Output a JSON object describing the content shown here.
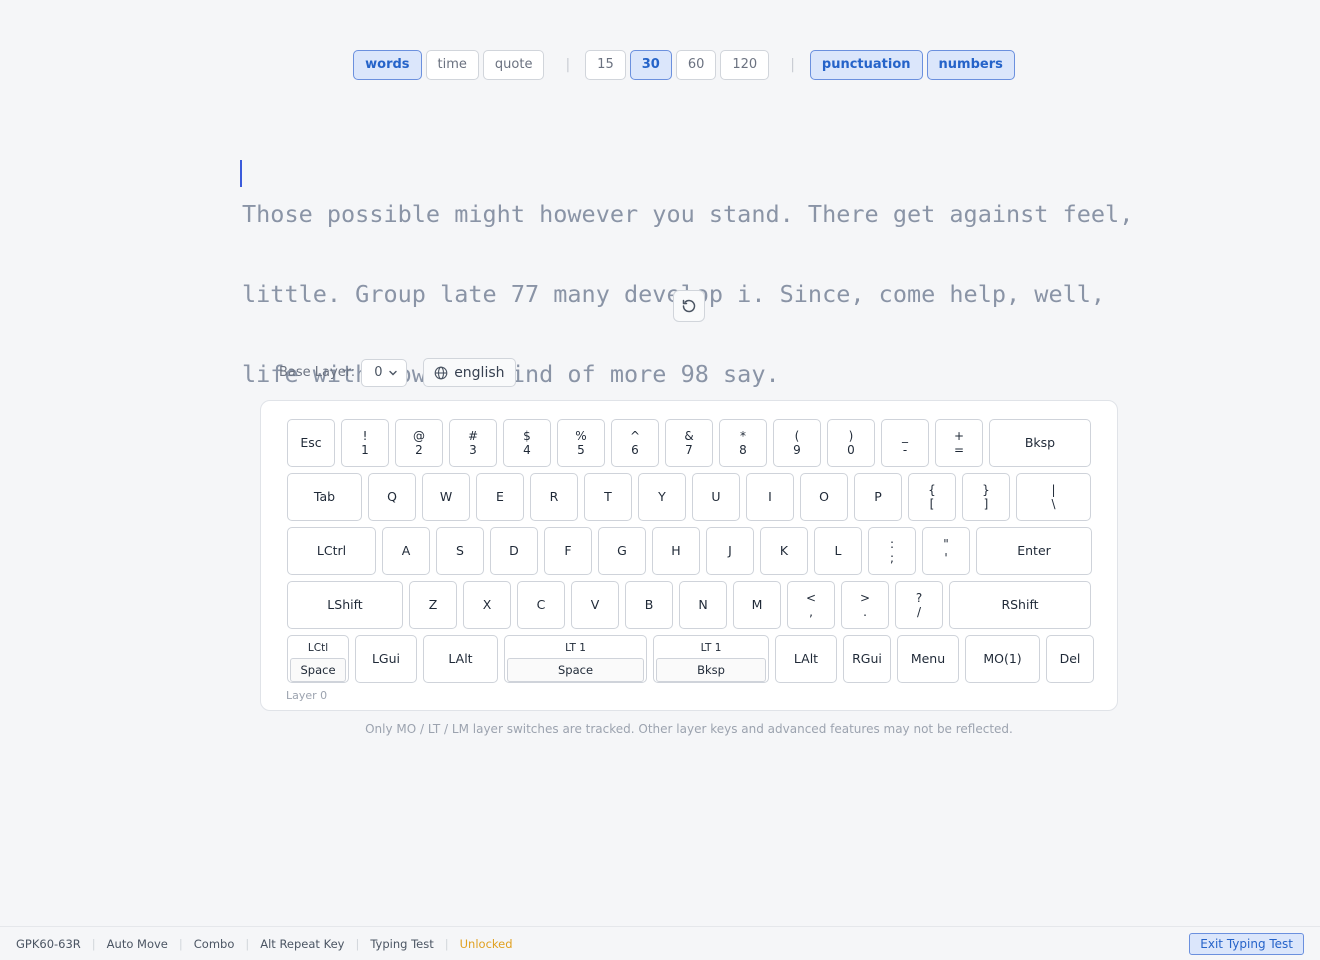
{
  "mode_bar": {
    "modes": [
      {
        "label": "words",
        "active": true
      },
      {
        "label": "time",
        "active": false
      },
      {
        "label": "quote",
        "active": false
      }
    ],
    "separator": "|",
    "counts": [
      {
        "label": "15",
        "active": false
      },
      {
        "label": "30",
        "active": true
      },
      {
        "label": "60",
        "active": false
      },
      {
        "label": "120",
        "active": false
      }
    ],
    "toggles": [
      {
        "label": "punctuation",
        "active": true
      },
      {
        "label": "numbers",
        "active": true
      }
    ]
  },
  "typing": {
    "lines": [
      "Those possible might however you stand. There get against feel,",
      "little. Group late 77 many develop i. Since, come help, well,",
      "life with down i. Find of more 98 say."
    ]
  },
  "layer_controls": {
    "base_layer_label": "Base Layer:",
    "base_layer_value": "0",
    "language": "english"
  },
  "keyboard": {
    "layer_label": "Layer 0",
    "rows": [
      [
        {
          "main": "Esc"
        },
        {
          "shift": "!",
          "base": "1"
        },
        {
          "shift": "@",
          "base": "2"
        },
        {
          "shift": "#",
          "base": "3"
        },
        {
          "shift": "$",
          "base": "4"
        },
        {
          "shift": "%",
          "base": "5"
        },
        {
          "shift": "^",
          "base": "6"
        },
        {
          "shift": "&",
          "base": "7"
        },
        {
          "shift": "*",
          "base": "8"
        },
        {
          "shift": "(",
          "base": "9"
        },
        {
          "shift": ")",
          "base": "0"
        },
        {
          "shift": "_",
          "base": "-"
        },
        {
          "shift": "+",
          "base": "="
        },
        {
          "main": "Bksp"
        }
      ],
      [
        {
          "main": "Tab"
        },
        {
          "main": "Q"
        },
        {
          "main": "W"
        },
        {
          "main": "E"
        },
        {
          "main": "R"
        },
        {
          "main": "T"
        },
        {
          "main": "Y"
        },
        {
          "main": "U"
        },
        {
          "main": "I"
        },
        {
          "main": "O"
        },
        {
          "main": "P"
        },
        {
          "shift": "{",
          "base": "["
        },
        {
          "shift": "}",
          "base": "]"
        },
        {
          "shift": "|",
          "base": "\\"
        }
      ],
      [
        {
          "main": "LCtrl"
        },
        {
          "main": "A"
        },
        {
          "main": "S"
        },
        {
          "main": "D"
        },
        {
          "main": "F"
        },
        {
          "main": "G"
        },
        {
          "main": "H"
        },
        {
          "main": "J"
        },
        {
          "main": "K"
        },
        {
          "main": "L"
        },
        {
          "shift": ":",
          "base": ";"
        },
        {
          "shift": "\"",
          "base": "'"
        },
        {
          "main": "Enter"
        }
      ],
      [
        {
          "main": "LShift"
        },
        {
          "main": "Z"
        },
        {
          "main": "X"
        },
        {
          "main": "C"
        },
        {
          "main": "V"
        },
        {
          "main": "B"
        },
        {
          "main": "N"
        },
        {
          "main": "M"
        },
        {
          "shift": "<",
          "base": ","
        },
        {
          "shift": ">",
          "base": "."
        },
        {
          "shift": "?",
          "base": "/"
        },
        {
          "main": "RShift"
        }
      ],
      [
        {
          "hold": "LCtl",
          "tap": "Space"
        },
        {
          "main": "LGui"
        },
        {
          "main": "LAlt"
        },
        {
          "hold": "LT 1",
          "tap": "Space"
        },
        {
          "hold": "LT 1",
          "tap": "Bksp"
        },
        {
          "main": "LAlt"
        },
        {
          "main": "RGui"
        },
        {
          "main": "Menu"
        },
        {
          "main": "MO(1)"
        },
        {
          "main": "Del"
        }
      ]
    ]
  },
  "note": "Only MO / LT / LM layer switches are tracked. Other layer keys and advanced features may not be reflected.",
  "status_bar": {
    "items": [
      "GPK60-63R",
      "Auto Move",
      "Combo",
      "Alt Repeat Key",
      "Typing Test"
    ],
    "separator": "|",
    "unlocked": "Unlocked",
    "unlocked_color": "#e0a020",
    "exit_button": "Exit Typing Test"
  },
  "colors": {
    "accent": "#2563c9",
    "accent_bg": "#dbe6fb",
    "caret": "#3b5bdb",
    "untyped_text": "#8a94a6"
  }
}
